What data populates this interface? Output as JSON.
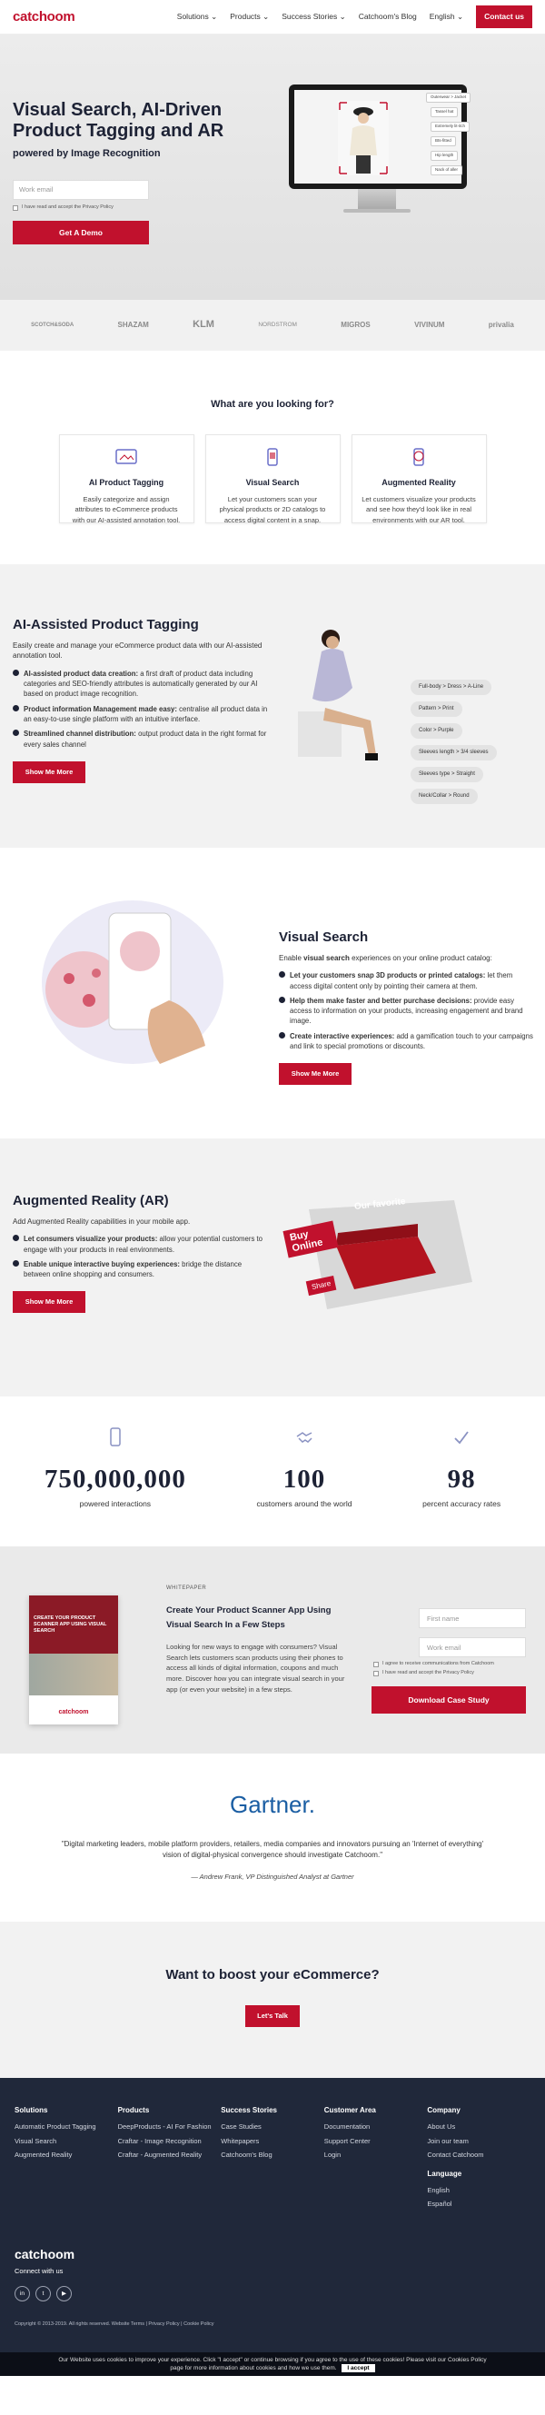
{
  "header": {
    "logo": "catchoom",
    "nav": [
      "Solutions ⌄",
      "Products ⌄",
      "Success Stories ⌄",
      "Catchoom's Blog",
      "English ⌄"
    ],
    "cta": "Contact us"
  },
  "hero": {
    "title": "Visual Search, AI-Driven Product Tagging and AR",
    "subtitle": "powered by Image Recognition",
    "email_placeholder": "Work email",
    "consent": "I have read and accept the Privacy Policy",
    "button": "Get A Demo",
    "tags": [
      "Outerwear > Jacket",
      "Tassel hat",
      "Extremely lit-itch",
      "Bts-fitted",
      "Hip length",
      "Nack of aller"
    ]
  },
  "brands": [
    "SCOTCH&SODA",
    "SHAZAM",
    "KLM",
    "NORDSTROM",
    "MIGROS",
    "VIVINUM",
    "privalia"
  ],
  "looking": {
    "title": "What are you looking for?",
    "cards": [
      {
        "title": "AI Product Tagging",
        "text": "Easily categorize and assign attributes to eCommerce products with our AI-assisted annotation tool."
      },
      {
        "title": "Visual Search",
        "text": "Let your customers scan your physical products or 2D catalogs to access digital content in a snap."
      },
      {
        "title": "Augmented Reality",
        "text": "Let customers visualize your products and see how they'd look like in real environments with our AR tool."
      }
    ]
  },
  "tagging": {
    "title": "AI-Assisted Product Tagging",
    "lead": "Easily create and manage your eCommerce product data with our AI-assisted annotation tool.",
    "items": [
      {
        "b": "AI-assisted product data creation:",
        "t": " a first draft of product data including categories and SEO-friendly attributes is automatically generated by our AI based on product image recognition."
      },
      {
        "b": "Product information Management made easy:",
        "t": " centralise all product data in an easy-to-use single platform with an intuitive interface."
      },
      {
        "b": "Streamlined channel distribution:",
        "t": " output product data in the right format for every sales channel"
      }
    ],
    "button": "Show Me More",
    "tags": [
      "Full-body > Dress > A-Line",
      "Pattern > Print",
      "Color > Purple",
      "Sleeves length > 3/4 sleeves",
      "Sleeves type > Straight",
      "Neck/Collar > Round"
    ]
  },
  "vsearch": {
    "title": "Visual Search",
    "lead_a": "Enable ",
    "lead_b": "visual search",
    "lead_c": " experiences on your online product catalog:",
    "items": [
      {
        "b": "Let your customers snap 3D products or printed catalogs:",
        "t": " let them access digital content only by pointing their camera at them."
      },
      {
        "b": "Help them make faster and better purchase decisions:",
        "t": " provide easy access to information on your products, increasing engagement and brand image."
      },
      {
        "b": "Create interactive experiences:",
        "t": " add a gamification touch to your campaigns and link to special promotions or discounts."
      }
    ],
    "button": "Show Me More"
  },
  "ar": {
    "title": "Augmented Reality (AR)",
    "lead": "Add Augmented Reality capabilities in your mobile app.",
    "items": [
      {
        "b": "Let consumers visualize your products:",
        "t": " allow your potential customers to engage with your products in real environments."
      },
      {
        "b": "Enable unique interactive buying experiences:",
        "t": " bridge the distance between online shopping and consumers."
      }
    ],
    "button": "Show Me More",
    "sign": "Buy Online",
    "share": "Share",
    "sofa": "Our favorite"
  },
  "stats": [
    {
      "n": "750,000,000",
      "l": "powered interactions"
    },
    {
      "n": "100",
      "l": "customers around the world"
    },
    {
      "n": "98",
      "l": "percent accuracy rates"
    }
  ],
  "whitepaper": {
    "kicker": "WHITEPAPER",
    "title": "Create Your Product Scanner App Using Visual Search In a Few Steps",
    "text": "Looking for new ways to engage with consumers? Visual Search lets customers scan products using their phones to access all kinds of digital information, coupons and much more. Discover how you can integrate visual search in your app (or even your website) in a few steps.",
    "first_name": "First name",
    "email": "Work email",
    "consent1": "I agree to receive communications from Catchoom",
    "consent2": "I have read and accept the Privacy Policy",
    "button": "Download Case Study",
    "cover": "CREATE YOUR PRODUCT SCANNER APP USING VISUAL SEARCH",
    "cover_logo": "catchoom"
  },
  "gartner": {
    "logo": "Gartner.",
    "quote": "\"Digital marketing leaders, mobile platform providers, retailers, media companies and innovators pursuing an 'Internet of everything' vision of digital-physical convergence should investigate Catchoom.\"",
    "author": "— Andrew Frank, VP Distinguished Analyst at Gartner"
  },
  "boost": {
    "title": "Want to boost your eCommerce?",
    "button": "Let's Talk"
  },
  "footer": {
    "cols": [
      {
        "h": "Solutions",
        "items": [
          "Automatic Product Tagging",
          "Visual Search",
          "Augmented Reality"
        ]
      },
      {
        "h": "Products",
        "items": [
          "DeepProducts - AI For Fashion",
          "Craftar - Image Recognition",
          "Craftar - Augmented Reality"
        ]
      },
      {
        "h": "Success Stories",
        "items": [
          "Case Studies",
          "Whitepapers",
          "Catchoom's Blog"
        ]
      },
      {
        "h": "Customer Area",
        "items": [
          "Documentation",
          "Support Center",
          "Login"
        ]
      },
      {
        "h": "Company",
        "items": [
          "About Us",
          "Join our team",
          "Contact Catchoom"
        ]
      }
    ],
    "lang_h": "Language",
    "langs": [
      "English",
      "Español"
    ],
    "logo": "catchoom",
    "connect": "Connect with us",
    "social": [
      "in",
      "t",
      "▶"
    ],
    "copyright": "Copyright © 2013-2019. All rights reserved. Website Terms | Privacy Policy | Cookie Policy"
  },
  "cookie": {
    "text": "Our Website uses cookies to improve your experience. Click \"I accept\" or continue browsing if you agree to the use of these cookies! Please visit our Cookies Policy page for more information about cookies and how we use them.",
    "accept": "I accept"
  },
  "colors": {
    "brand": "#c1112d",
    "dark": "#1d2235",
    "footer": "#20283a"
  }
}
